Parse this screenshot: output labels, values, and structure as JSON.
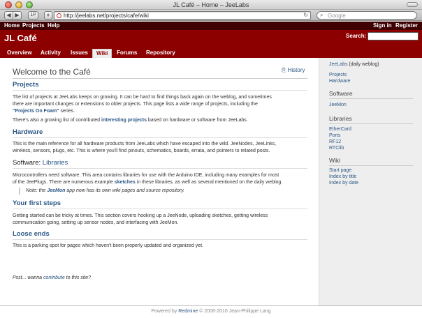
{
  "browser": {
    "window_title": "JL Café – Home – JeeLabs",
    "url": "http://jeelabs.net/projects/cafe/wiki",
    "search_placeholder": "Google",
    "back_glyph": "◀",
    "forward_glyph": "▶",
    "reader_glyph": "1P",
    "plus_glyph": "+",
    "reload_glyph": "↻",
    "search_glyph": "⌕"
  },
  "topmenu": {
    "left": [
      "Home",
      "Projects",
      "Help"
    ],
    "right": [
      "Sign in",
      "Register"
    ]
  },
  "header": {
    "title": "JL Café",
    "search_label": "Search:"
  },
  "tabs": [
    "Overview",
    "Activity",
    "Issues",
    "Wiki",
    "Forums",
    "Repository"
  ],
  "selected_tab": "Wiki",
  "wiki": {
    "title": "Welcome to the Café",
    "history_label": "History",
    "sections": {
      "projects": {
        "heading": "Projects",
        "p1_line1": "The list of projects at JeeLabs keeps on growing. It can be hard to find things back again on the weblog, and sometimes",
        "p1_line2": "there are important changes or extensions to older projects. This page lists a wide range of projects, including the",
        "p1_link": "\"Projects On Foam\"",
        "p1_end": " series.",
        "p2_start": "There's also a growing list of contributed ",
        "p2_link": "interesting projects",
        "p2_end": " based on hardware or software from JeeLabs."
      },
      "hardware": {
        "heading": "Hardware",
        "line1": "This is the main reference for all hardware products from JeeLabs which have escaped into the wild. JeeNodes, JeeLinks,",
        "line2": "wireless, sensors, plugs, etc. This is where you'll find pinouts, schematics, boards, errata, and pointers to related posts."
      },
      "software": {
        "heading_prefix": "Software: ",
        "heading_link": "Libraries",
        "line1": "Microcontrollers need software. This area contains libraries for use with the Arduino IDE, including many examples for most",
        "line2_start": "of the JeePlugs. There are numerous example ",
        "line2_link": "sketches",
        "line2_end": " in these libraries, as well as several mentioned on the daily weblog.",
        "note_start": "Note: the ",
        "note_link": "JeeMon",
        "note_end": " app now has its own wiki pages and source repository."
      },
      "first_steps": {
        "heading": "Your first steps",
        "line1": "Getting started can be tricky at times. This section covers hooking up a JeeNode, uploading sketches, getting wireless",
        "line2": "communication going, setting up sensor nodes, and interfacing with JeeMon."
      },
      "loose_ends": {
        "heading": "Loose ends",
        "line1": "This is a parking spot for pages which haven't been properly updated and organized yet."
      }
    },
    "psst_start": "Psst... wanna ",
    "psst_link": "contribute",
    "psst_end": " to this site?"
  },
  "sidebar": {
    "weblog_link": "JeeLabs",
    "weblog_text": " (daily weblog)",
    "top_links": [
      "Projects",
      "Hardware"
    ],
    "software_heading": "Software",
    "software_links": [
      "JeeMon"
    ],
    "libraries_heading": "Libraries",
    "library_links": [
      "EtherCard",
      "Ports",
      "RF12",
      "RTClib"
    ],
    "wiki_heading": "Wiki",
    "wiki_links": [
      "Start page",
      "Index by title",
      "Index by date"
    ]
  },
  "footer": {
    "prefix": "Powered by ",
    "link": "Redmine",
    "suffix": " © 2006-2010 Jean-Philippe Lang"
  },
  "colors": {
    "header_bg": "#8c0000",
    "topmenu_bg": "#3e0000",
    "link": "#2a5685",
    "sidebar_bg": "#eeeeee"
  }
}
